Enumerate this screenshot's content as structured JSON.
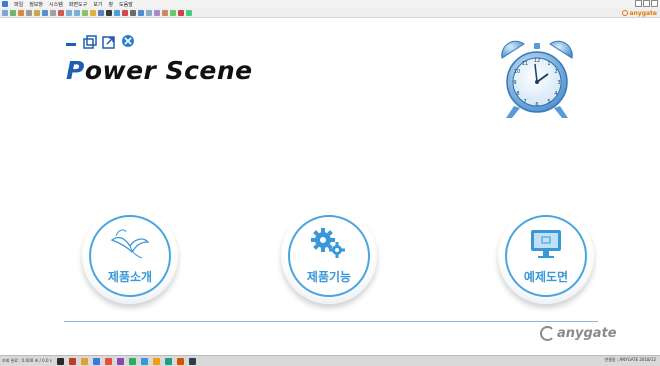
{
  "menubar": {
    "items": [
      "파일",
      "정보창",
      "시스템",
      "화면도구",
      "보기",
      "창",
      "도움말"
    ]
  },
  "toolbar": {
    "brand": "anygate"
  },
  "header": {
    "controls": [
      "minimize-icon",
      "restore-icon",
      "maximize-icon",
      "close-icon"
    ],
    "title_first": "P",
    "title_rest": "ower Scene"
  },
  "buttons": [
    {
      "label": "제품소개",
      "icon": "bird-icon"
    },
    {
      "label": "제품기능",
      "icon": "gears-icon"
    },
    {
      "label": "예제도면",
      "icon": "monitor-icon"
    }
  ],
  "footer": {
    "brand": "anygate"
  },
  "taskbar": {
    "status_left": "조회 완료 : 0.000 초 / 0.0 s",
    "status_right": "연결됨 : ANYGATE 2018/12"
  },
  "colors": {
    "accent": "#3a97d8",
    "title_accent": "#1f5fb0",
    "ring": "#4ba3e0"
  }
}
